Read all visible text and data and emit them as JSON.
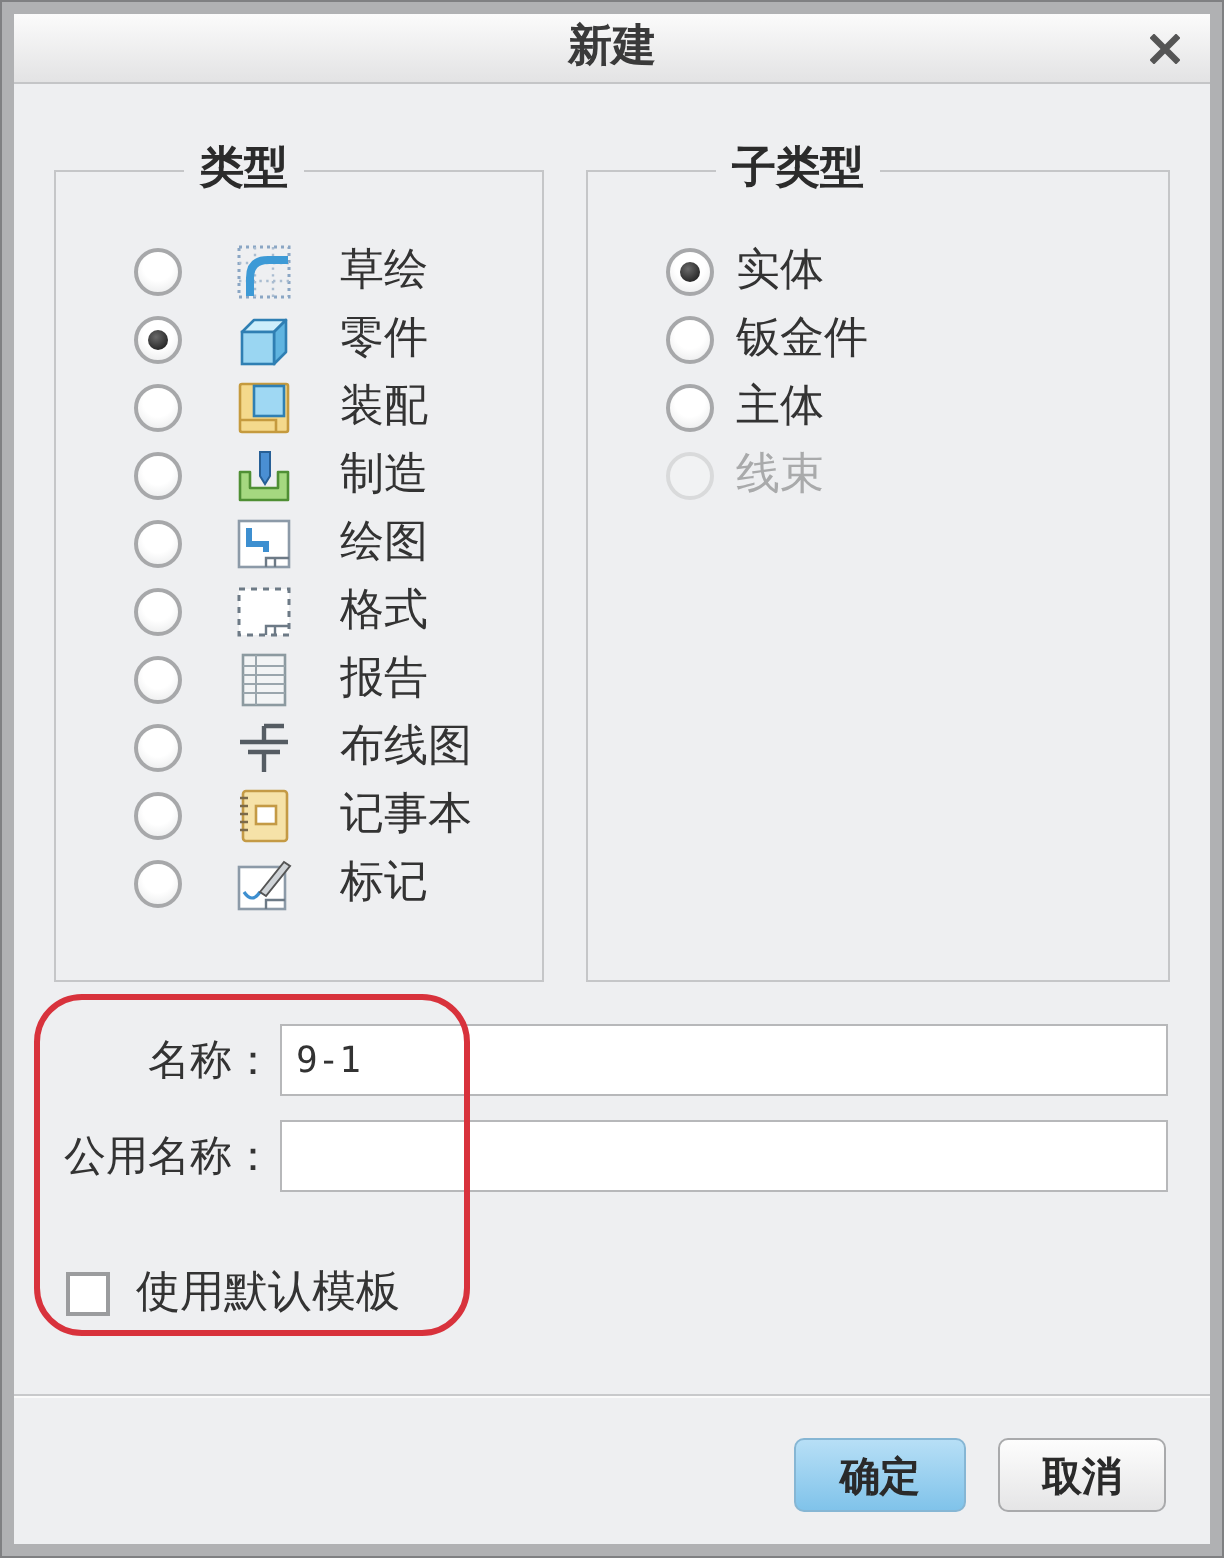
{
  "window": {
    "title": "新建"
  },
  "type_group": {
    "title": "类型",
    "options": [
      {
        "label": "草绘",
        "selected": false
      },
      {
        "label": "零件",
        "selected": true
      },
      {
        "label": "装配",
        "selected": false
      },
      {
        "label": "制造",
        "selected": false
      },
      {
        "label": "绘图",
        "selected": false
      },
      {
        "label": "格式",
        "selected": false
      },
      {
        "label": "报告",
        "selected": false
      },
      {
        "label": "布线图",
        "selected": false
      },
      {
        "label": "记事本",
        "selected": false
      },
      {
        "label": "标记",
        "selected": false
      }
    ]
  },
  "subtype_group": {
    "title": "子类型",
    "options": [
      {
        "label": "实体",
        "selected": true,
        "disabled": false
      },
      {
        "label": "钣金件",
        "selected": false,
        "disabled": false
      },
      {
        "label": "主体",
        "selected": false,
        "disabled": false
      },
      {
        "label": "线束",
        "selected": false,
        "disabled": true
      }
    ]
  },
  "fields": [
    {
      "label": "名称：",
      "value": "9-1"
    },
    {
      "label": "公用名称："
    }
  ],
  "template_checkbox": {
    "label": "使用默认模板",
    "checked": false
  },
  "buttons": [
    {
      "label": "确定",
      "kind": "primary"
    },
    {
      "label": "取消",
      "kind": "secondary"
    }
  ]
}
